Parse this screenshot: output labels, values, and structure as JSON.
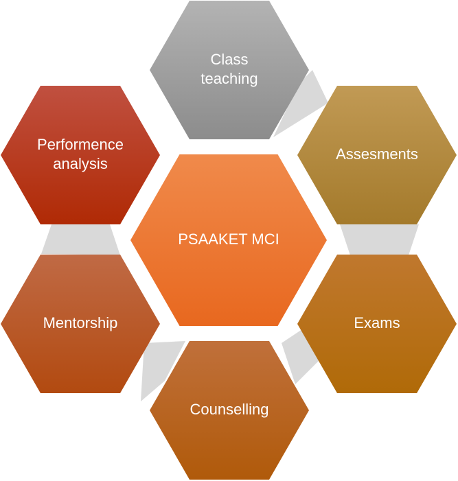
{
  "diagram": {
    "center": {
      "label_lines": [
        "PSAAKET MCI"
      ],
      "color_top": "#f08a4b",
      "color_bottom": "#e8681f"
    },
    "nodes": [
      {
        "id": "class-teaching",
        "label_lines": [
          "Class",
          "teaching"
        ],
        "color_top": "#b3b3b3",
        "color_bottom": "#8c8c8c"
      },
      {
        "id": "assesments",
        "label_lines": [
          "Assesments"
        ],
        "color_top": "#c19a55",
        "color_bottom": "#a47a2b"
      },
      {
        "id": "exams",
        "label_lines": [
          "Exams"
        ],
        "color_top": "#c0782e",
        "color_bottom": "#b06a08"
      },
      {
        "id": "counselling",
        "label_lines": [
          "Counselling"
        ],
        "color_top": "#c0703b",
        "color_bottom": "#b05a0a"
      },
      {
        "id": "mentorship",
        "label_lines": [
          "Mentorship"
        ],
        "color_top": "#c06a45",
        "color_bottom": "#b24a10"
      },
      {
        "id": "performence-analysis",
        "label_lines": [
          "Performence",
          "analysis"
        ],
        "color_top": "#c05040",
        "color_bottom": "#b02a05"
      }
    ],
    "connector_color": "#d9d9d9"
  }
}
